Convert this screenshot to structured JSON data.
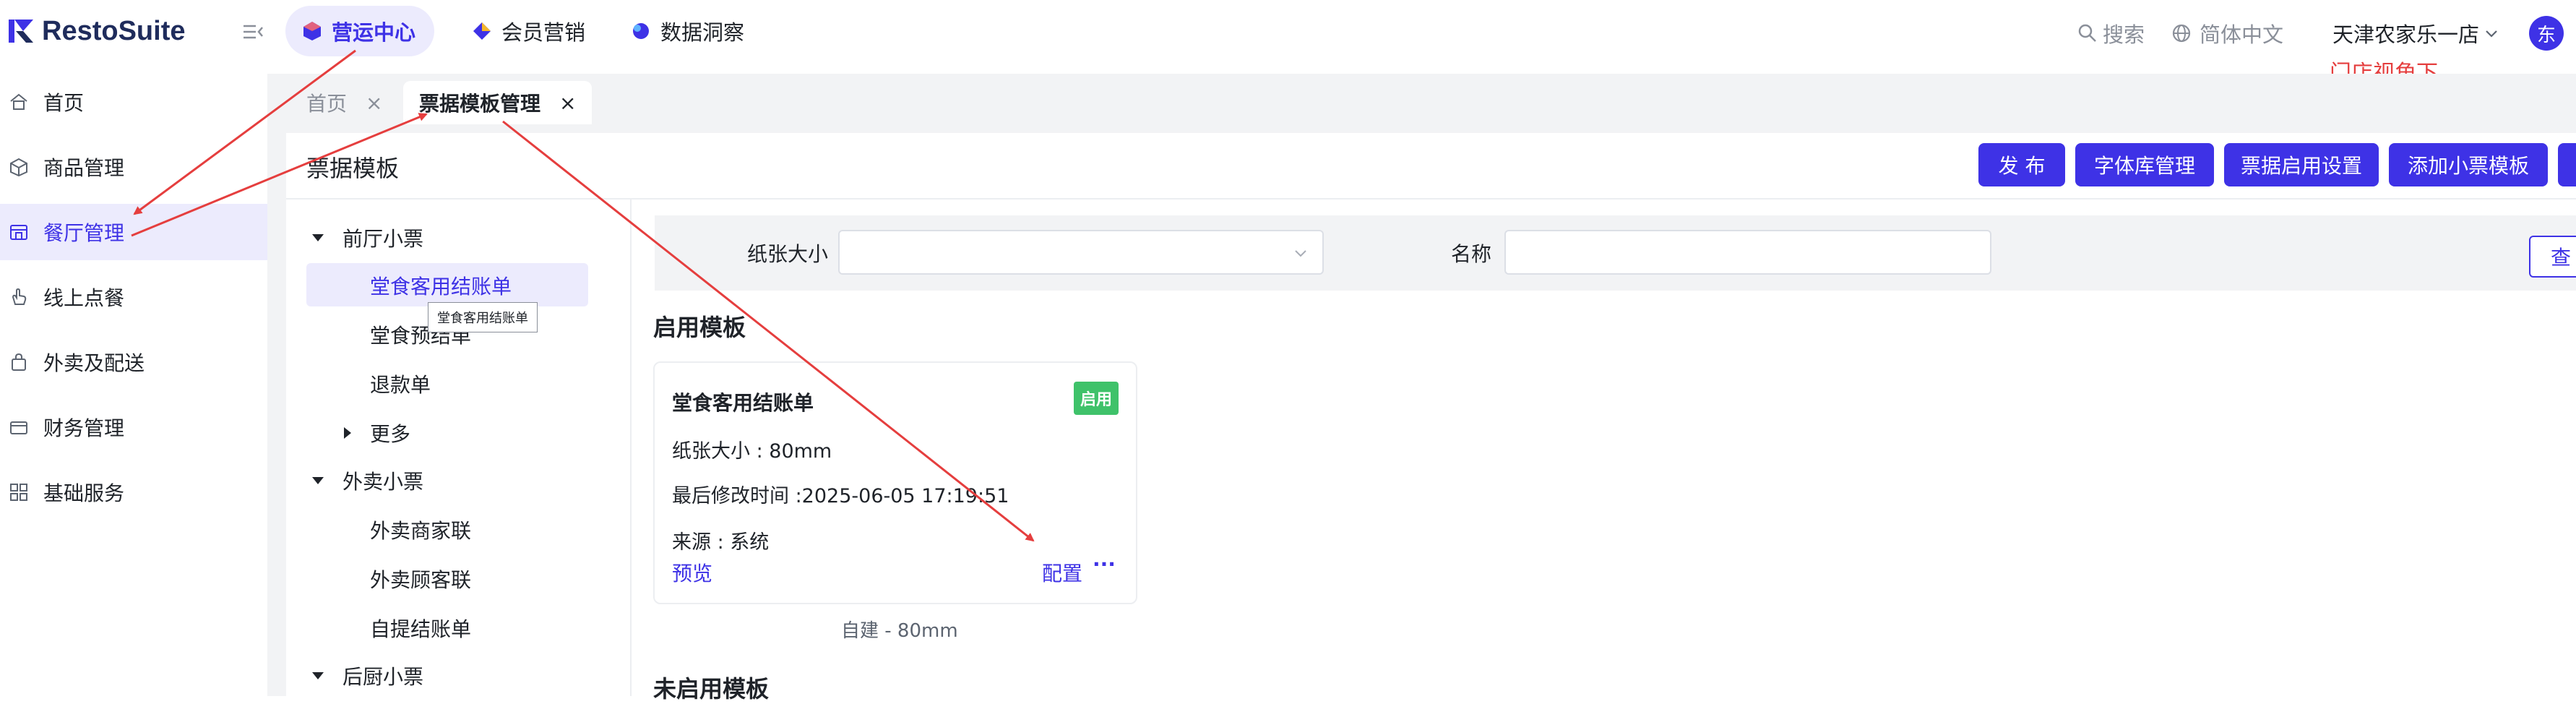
{
  "app": {
    "brand": "RestoSuite"
  },
  "topnav": [
    {
      "label": "营运中心",
      "icon": "hexagon-icon",
      "active": true
    },
    {
      "label": "会员营销",
      "icon": "diamond-icon",
      "active": false
    },
    {
      "label": "数据洞察",
      "icon": "bubble-icon",
      "active": false
    }
  ],
  "topright": {
    "search": "搜索",
    "language": "简体中文",
    "store": "天津农家乐一店",
    "avatar": "东"
  },
  "annotation": {
    "store_note": "门店视角下"
  },
  "sidebar": {
    "items": [
      {
        "label": "首页",
        "icon": "home-icon"
      },
      {
        "label": "商品管理",
        "icon": "box-icon"
      },
      {
        "label": "餐厅管理",
        "icon": "store-icon",
        "active": true
      },
      {
        "label": "线上点餐",
        "icon": "hand-icon"
      },
      {
        "label": "外卖及配送",
        "icon": "bag-icon"
      },
      {
        "label": "财务管理",
        "icon": "wallet-icon"
      },
      {
        "label": "基础服务",
        "icon": "grid-icon"
      }
    ]
  },
  "tabs": [
    {
      "label": "首页",
      "active": false
    },
    {
      "label": "票据模板管理",
      "active": true
    }
  ],
  "page": {
    "title": "票据模板",
    "buttons": [
      "发 布",
      "字体库管理",
      "票据启用设置",
      "添加小票模板"
    ]
  },
  "tree": {
    "groups": [
      {
        "label": "前厅小票",
        "children": [
          "堂食客用结账单",
          "堂食预结单",
          "退款单"
        ],
        "more": "更多"
      },
      {
        "label": "外卖小票",
        "children": [
          "外卖商家联",
          "外卖顾客联",
          "自提结账单"
        ]
      },
      {
        "label": "后厨小票"
      }
    ],
    "tooltip": "堂食客用结账单"
  },
  "filters": {
    "paper_label": "纸张大小",
    "paper_value": "",
    "name_label": "名称",
    "name_value": "",
    "query": "查"
  },
  "enabled": {
    "title": "启用模板",
    "card": {
      "name": "堂食客用结账单",
      "status": "启用",
      "paper": "纸张大小 : 80mm",
      "modified": "最后修改时间 :2025-06-05 17:19:51",
      "source": "来源 : 系统",
      "preview": "预览",
      "config": "配置",
      "more": "···"
    },
    "caption": "自建 - 80mm"
  },
  "disabled": {
    "title": "未启用模板"
  },
  "colors": {
    "accent": "#3e32e6",
    "accent_light": "#ecebfd",
    "success": "#3fc26a",
    "annotation": "#e53e3e"
  }
}
